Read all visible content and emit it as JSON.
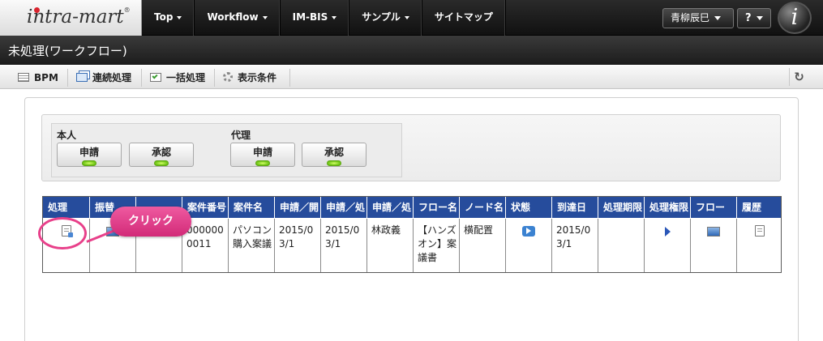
{
  "header": {
    "logo_text": "intra-mart",
    "logo_mark": "®",
    "nav": [
      {
        "label": "Top",
        "has_menu": true
      },
      {
        "label": "Workflow",
        "has_menu": true
      },
      {
        "label": "IM-BIS",
        "has_menu": true
      },
      {
        "label": "サンプル",
        "has_menu": true
      },
      {
        "label": "サイトマップ",
        "has_menu": false
      }
    ],
    "user_name": "青柳辰巳",
    "help_label": "?",
    "brand_badge": "i"
  },
  "page_title": "未処理(ワークフロー)",
  "toolbar": {
    "bpm": "BPM",
    "sequential": "連続処理",
    "bulk": "一括処理",
    "display_conditions": "表示条件"
  },
  "filter": {
    "self_label": "本人",
    "proxy_label": "代理",
    "apply_label": "申請",
    "approve_label": "承認"
  },
  "table": {
    "headers": [
      "処理",
      "振替",
      "",
      "案件番号",
      "案件名",
      "申請／開",
      "申請／処",
      "申請／処",
      "フロー名",
      "ノード名",
      "状態",
      "到達日",
      "処理期限",
      "処理権限",
      "フロー",
      "履歴"
    ],
    "row": {
      "matter_number": "0000000011",
      "matter_name": "パソコン購入案議",
      "applied_date": "2015/03/1",
      "processed_date": "2015/03/1",
      "applicant": "林政義",
      "flow_name": "【ハンズオン】案議書",
      "node_name": "横配置",
      "arrival_date": "2015/03/1",
      "deadline": ""
    }
  },
  "annotation": {
    "callout": "クリック"
  },
  "colors": {
    "header_bg": "#1b1b1b",
    "table_header": "#264c9c",
    "callout": "#e8408a",
    "led": "#6cc313"
  }
}
